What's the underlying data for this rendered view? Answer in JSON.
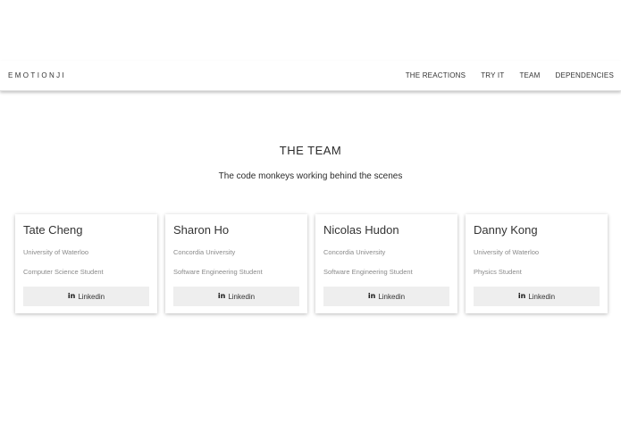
{
  "nav": {
    "brand": "EMOTIONJI",
    "links": [
      "THE REACTIONS",
      "TRY IT",
      "TEAM",
      "DEPENDENCIES"
    ]
  },
  "team": {
    "title": "THE TEAM",
    "subtitle": "The code monkeys working behind the scenes",
    "members": [
      {
        "name": "Tate Cheng",
        "school": "University of Waterloo",
        "program": "Computer Science Student",
        "button_label": "Linkedin",
        "button_icon": "in"
      },
      {
        "name": "Sharon Ho",
        "school": "Concordia University",
        "program": "Software Engineering Student",
        "button_label": "Linkedin",
        "button_icon": "in"
      },
      {
        "name": "Nicolas Hudon",
        "school": "Concordia University",
        "program": "Software Engineering Student",
        "button_label": "Linkedin",
        "button_icon": "in"
      },
      {
        "name": "Danny Kong",
        "school": "University of Waterloo",
        "program": "Physics Student",
        "button_label": "Linkedin",
        "button_icon": "in"
      }
    ]
  },
  "colors": {
    "background": "#ffffff",
    "text": "#333333",
    "muted_text": "#8a8a8a",
    "button_bg": "#eeeeee"
  }
}
